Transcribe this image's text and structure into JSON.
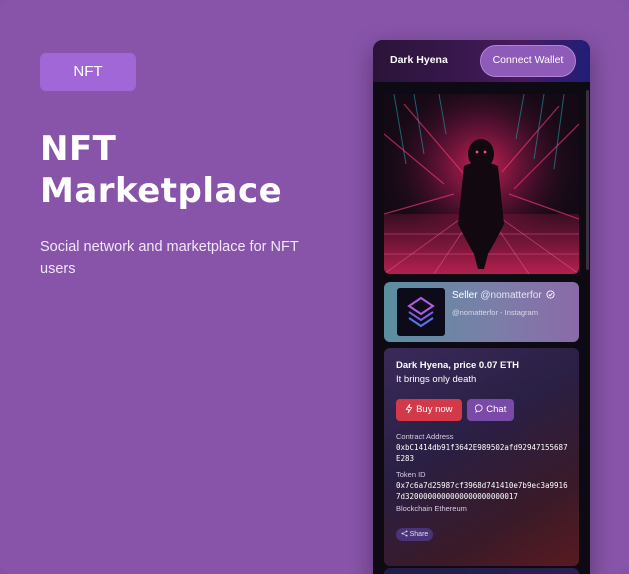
{
  "hero": {
    "tag": "NFT",
    "title": "NFT Marketplace",
    "subtitle": "Social network and marketplace for NFT users"
  },
  "app": {
    "brand": "Dark Hyena",
    "connect_label": "Connect Wallet",
    "seller": {
      "label": "Seller",
      "handle": "@nomatterfor",
      "source": "@nomatterfor - Instagram"
    },
    "item": {
      "title": "Dark Hyena, price 0.07 ETH",
      "description": "It brings only death",
      "buy_label": "Buy now",
      "chat_label": "Chat",
      "contract_label": "Contract Address",
      "contract_value": "0xbC1414db91f3642E989502afd92947155687E283",
      "token_label": "Token ID",
      "token_value": "0x7c6a7d25987cf3968d741410e7b9ec3a99167d3200000000000000000000017",
      "blockchain": "Blockchain Ethereum",
      "share_label": "Share"
    }
  },
  "colors": {
    "background": "#8754a9",
    "tag": "#a267d6",
    "buy": "#d23a4a",
    "chat": "#7a4aa8"
  }
}
